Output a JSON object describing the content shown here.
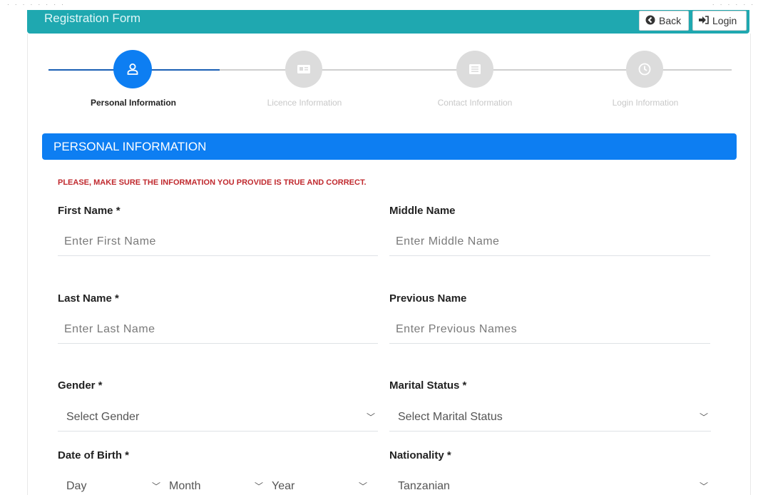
{
  "header": {
    "title": "Registration Form",
    "back_label": "Back",
    "login_label": "Login"
  },
  "steps": [
    {
      "label": "Personal Information",
      "icon": "user-icon"
    },
    {
      "label": "Licence Information",
      "icon": "id-card-icon"
    },
    {
      "label": "Contact Information",
      "icon": "list-icon"
    },
    {
      "label": "Login Information",
      "icon": "clock-icon"
    }
  ],
  "section": {
    "title": "PERSONAL INFORMATION",
    "warning": "PLEASE, MAKE SURE THE INFORMATION YOU PROVIDE IS TRUE AND CORRECT."
  },
  "form": {
    "first_name": {
      "label": "First Name *",
      "placeholder": "Enter First Name"
    },
    "middle_name": {
      "label": "Middle Name",
      "placeholder": "Enter Middle Name"
    },
    "last_name": {
      "label": "Last Name *",
      "placeholder": "Enter Last Name"
    },
    "previous_name": {
      "label": "Previous Name",
      "placeholder": "Enter Previous Names"
    },
    "gender": {
      "label": "Gender *",
      "value": "Select Gender"
    },
    "marital_status": {
      "label": "Marital Status *",
      "value": "Select Marital Status"
    },
    "dob": {
      "label": "Date of Birth *",
      "day": "Day",
      "month": "Month",
      "year": "Year"
    },
    "nationality": {
      "label": "Nationality *",
      "value": "Tanzanian"
    }
  },
  "colors": {
    "header_bg": "#1fa8b0",
    "primary": "#0d7ef2",
    "warning_text": "#c0292e",
    "step_inactive": "#dcdcdc"
  }
}
